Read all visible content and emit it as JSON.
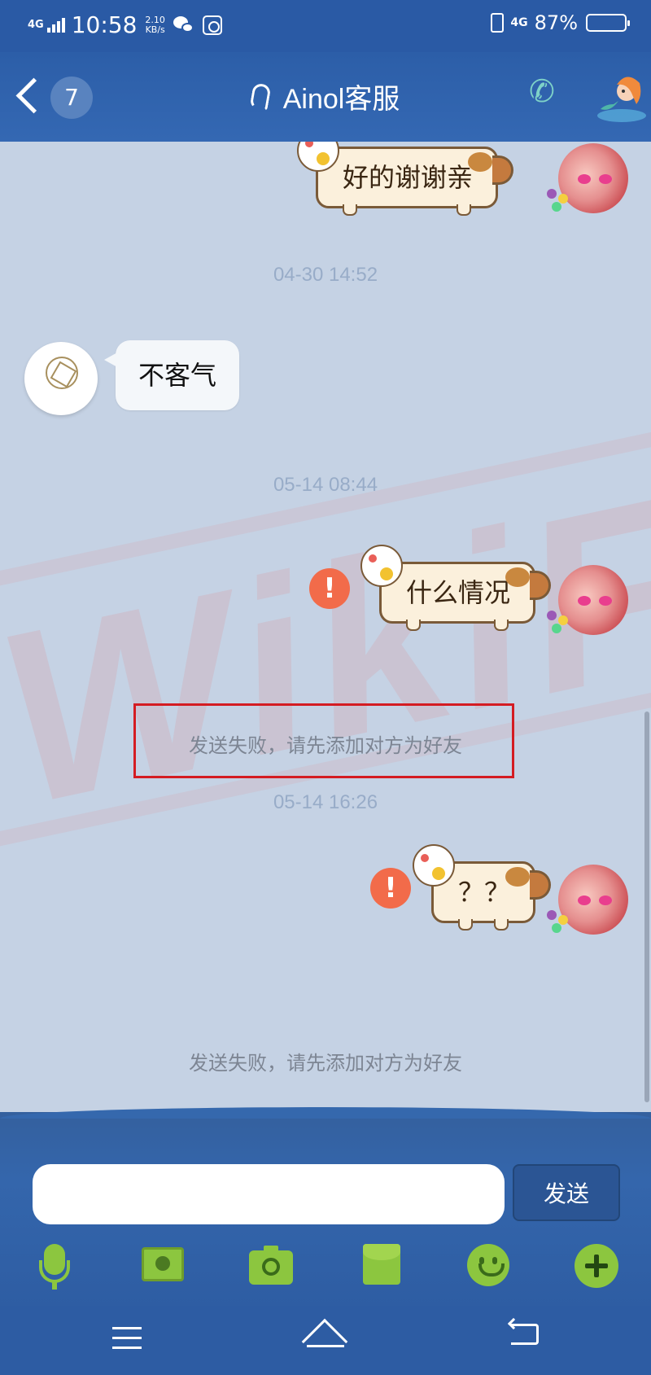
{
  "status_bar": {
    "network_left": "4G",
    "time": "10:58",
    "speed_value": "2.10",
    "speed_unit": "KB/s",
    "network_right": "4G",
    "battery_percent": "87%",
    "battery_level": 0.87
  },
  "header": {
    "unread_count": "7",
    "title": "Ainol客服"
  },
  "messages": [
    {
      "direction": "out",
      "text": "好的谢谢亲",
      "failed": false
    },
    {
      "type": "timestamp",
      "text": "04-30 14:52"
    },
    {
      "direction": "in",
      "text": "不客气"
    },
    {
      "type": "timestamp",
      "text": "05-14 08:44"
    },
    {
      "direction": "out",
      "text": "什么情况",
      "failed": true
    },
    {
      "type": "system",
      "text": "发送失败，请先添加对方为好友"
    },
    {
      "type": "timestamp",
      "text": "05-14 16:26"
    },
    {
      "direction": "out",
      "text": "？？",
      "failed": true
    },
    {
      "type": "system",
      "text": "发送失败，请先添加对方为好友"
    }
  ],
  "input": {
    "value": "",
    "placeholder": ""
  },
  "send_button_label": "发送",
  "toolbar_icons": [
    "microphone-icon",
    "picture-icon",
    "camera-icon",
    "red-packet-icon",
    "emoji-icon",
    "plus-icon"
  ],
  "nav_icons": [
    "menu-icon",
    "home-icon",
    "back-icon"
  ],
  "colors": {
    "header_bg": "#2c5ea8",
    "chat_bg": "#c5d2e4",
    "fail_icon": "#f26b4a",
    "highlight_box": "#d41c22",
    "tool_icons": "#8cc63f"
  }
}
